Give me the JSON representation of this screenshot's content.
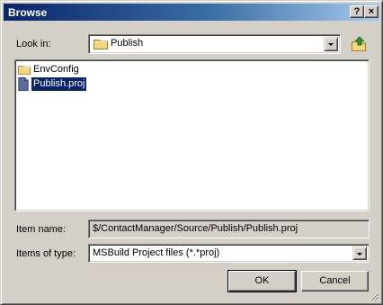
{
  "window": {
    "title": "Browse",
    "help_button": "?",
    "close_button": "×"
  },
  "look_in": {
    "label": "Look in:",
    "value": "Publish"
  },
  "file_list": {
    "items": [
      {
        "label": "EnvConfig",
        "icon": "folder-icon",
        "selected": false
      },
      {
        "label": "Publish.proj",
        "icon": "document-icon",
        "selected": true
      }
    ]
  },
  "item_name": {
    "label": "Item name:",
    "value": "$/ContactManager/Source/Publish/Publish.proj"
  },
  "items_of_type": {
    "label": "Items of type:",
    "value": "MSBuild Project files (*.*proj)"
  },
  "buttons": {
    "ok": "OK",
    "cancel": "Cancel"
  },
  "colors": {
    "face": "#d4d0c8",
    "title_start": "#0a246a",
    "title_end": "#a6caf0",
    "selection": "#0a246a"
  }
}
